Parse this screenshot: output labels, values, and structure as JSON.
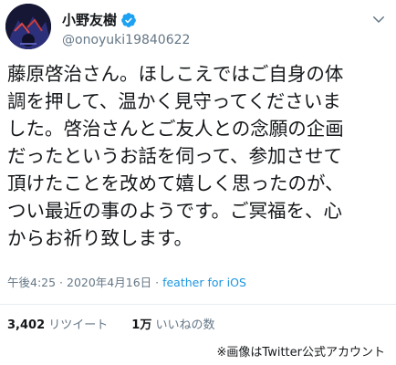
{
  "author": {
    "display_name": "小野友樹",
    "handle": "@onoyuki19840622",
    "verified_icon": "verified-badge-icon",
    "avatar_icon": "avatar-photo"
  },
  "tweet": {
    "lines": [
      "藤原啓治さん。ほしこえではご自身の体",
      "調を押して、温かく見守ってくださいま",
      "した。啓治さんとご友人との念願の企画",
      "だったというお話を伺って、参加させて",
      "頂けたことを改めて嬉しく思ったのが、",
      "つい最近の事のようです。ご冥福を、心",
      "からお祈り致します。"
    ]
  },
  "meta": {
    "time": "午後4:25",
    "separator": " · ",
    "date": "2020年4月16日",
    "separator2": " · ",
    "source": "feather for iOS"
  },
  "stats": {
    "retweets_count": "3,402",
    "retweets_label": "リツイート",
    "likes_count": "1万",
    "likes_label": "いいねの数"
  },
  "caption": "※画像はTwitter公式アカウント",
  "colors": {
    "verified_blue": "#1da1f2",
    "link_blue": "#1b95e0",
    "secondary_gray": "#657786"
  }
}
